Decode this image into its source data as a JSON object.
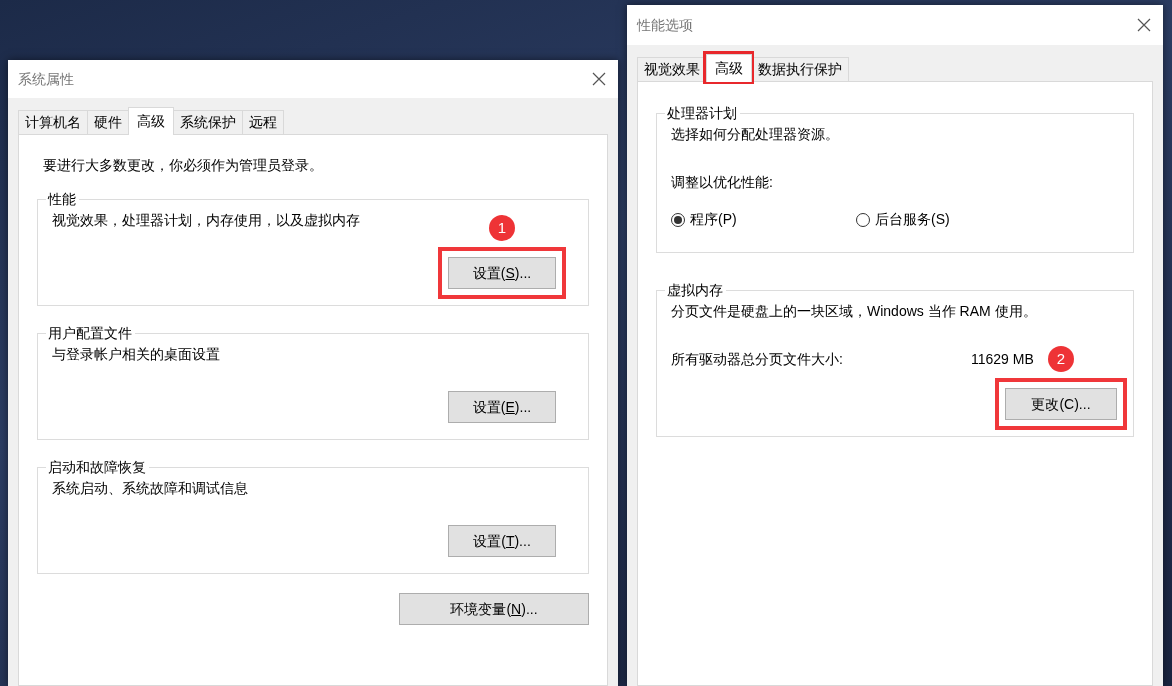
{
  "system_properties": {
    "title": "系统属性",
    "tabs": [
      {
        "label": "计算机名",
        "selected": false
      },
      {
        "label": "硬件",
        "selected": false
      },
      {
        "label": "高级",
        "selected": true
      },
      {
        "label": "系统保护",
        "selected": false
      },
      {
        "label": "远程",
        "selected": false
      }
    ],
    "notice": "要进行大多数更改，你必须作为管理员登录。",
    "groups": [
      {
        "title": "性能",
        "description": "视觉效果，处理器计划，内存使用，以及虚拟内存",
        "button": {
          "before": "设置(",
          "key": "S",
          "after": ")...",
          "highlighted": true,
          "marker": "1"
        }
      },
      {
        "title": "用户配置文件",
        "description": "与登录帐户相关的桌面设置",
        "button": {
          "before": "设置(",
          "key": "E",
          "after": ")..."
        }
      },
      {
        "title": "启动和故障恢复",
        "description": "系统启动、系统故障和调试信息",
        "button": {
          "before": "设置(",
          "key": "T",
          "after": ")..."
        }
      }
    ],
    "env_button": {
      "before": "环境变量(",
      "key": "N",
      "after": ")..."
    }
  },
  "performance_options": {
    "title": "性能选项",
    "tabs": [
      {
        "label": "视觉效果",
        "selected": false
      },
      {
        "label": "高级",
        "selected": true,
        "highlighted": true
      },
      {
        "label": "数据执行保护",
        "selected": false
      }
    ],
    "processor_group": {
      "title": "处理器计划",
      "description": "选择如何分配处理器资源。",
      "prompt": "调整以优化性能:",
      "options": [
        {
          "label": "程序(P)",
          "selected": true
        },
        {
          "label": "后台服务(S)",
          "selected": false
        }
      ]
    },
    "virtual_memory": {
      "title": "虚拟内存",
      "description": "分页文件是硬盘上的一块区域，Windows 当作 RAM 使用。",
      "size_label": "所有驱动器总分页文件大小:",
      "size_value": "11629 MB",
      "button": {
        "label": "更改(C)...",
        "highlighted": true,
        "marker": "2"
      }
    }
  }
}
